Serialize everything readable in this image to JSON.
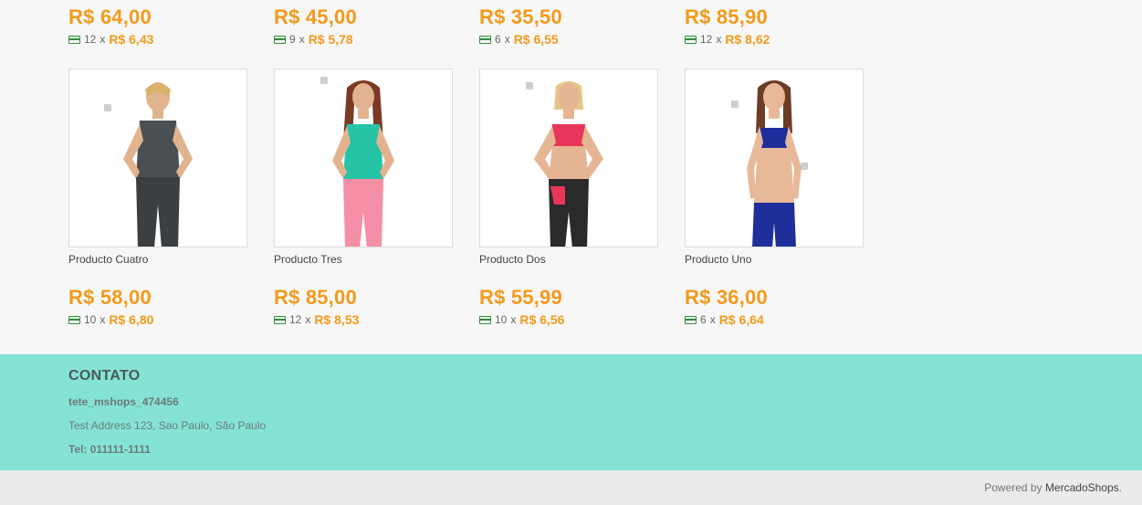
{
  "top_row": [
    {
      "price": "R$ 64,00",
      "installments": "12",
      "installment_value": "R$ 6,43"
    },
    {
      "price": "R$ 45,00",
      "installments": "9",
      "installment_value": "R$ 5,78"
    },
    {
      "price": "R$ 35,50",
      "installments": "6",
      "installment_value": "R$ 6,55"
    },
    {
      "price": "R$ 85,90",
      "installments": "12",
      "installment_value": "R$ 8,62"
    }
  ],
  "products": [
    {
      "name": "Producto Cuatro",
      "price": "R$ 58,00",
      "installments": "10",
      "installment_value": "R$ 6,80",
      "top_color": "#4b4f52",
      "bottom_color": "#3c3f42"
    },
    {
      "name": "Producto Tres",
      "price": "R$ 85,00",
      "installments": "12",
      "installment_value": "R$ 8,53",
      "top_color": "#25c4a6",
      "bottom_color": "#f58fa6"
    },
    {
      "name": "Producto Dos",
      "price": "R$ 55,99",
      "installments": "10",
      "installment_value": "R$ 6,56",
      "top_color": "#e8365b",
      "bottom_color": "#2a2a2a"
    },
    {
      "name": "Producto Uno",
      "price": "R$ 36,00",
      "installments": "6",
      "installment_value": "R$ 6,64",
      "top_color": "#1e2f9c",
      "bottom_color": "#1e2f9c"
    }
  ],
  "installment_separator": "x",
  "contact": {
    "title": "CONTATO",
    "store": "tete_mshops_474456",
    "address": "Test Address 123, Sao Paulo, São Paulo",
    "phone": "Tel: 011111-1111"
  },
  "footer": {
    "powered_prefix": "Powered by",
    "brand": "MercadoShops",
    "suffix": "."
  },
  "colors": {
    "price": "#f39a1b",
    "contact_bg": "#85e3d6",
    "footer_bg": "#ebebeb"
  }
}
